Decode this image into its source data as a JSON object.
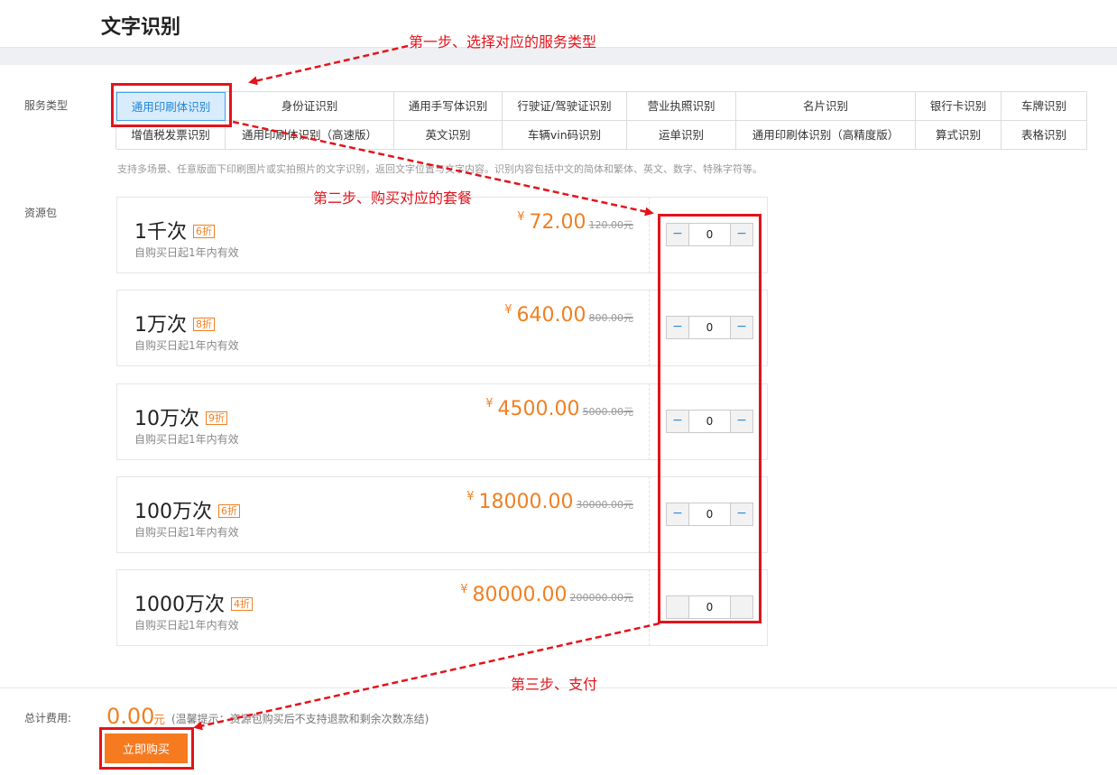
{
  "page": {
    "title": "文字识别"
  },
  "labels": {
    "service_type": "服务类型",
    "resource_pack": "资源包",
    "total_cost": "总计费用:"
  },
  "services": {
    "row1": [
      "通用印刷体识别",
      "身份证识别",
      "通用手写体识别",
      "行驶证/驾驶证识别",
      "营业执照识别",
      "名片识别",
      "银行卡识别",
      "车牌识别"
    ],
    "row2": [
      "增值税发票识别",
      "通用印刷体识别（高速版）",
      "英文识别",
      "车辆vin码识别",
      "运单识别",
      "通用印刷体识别（高精度版）",
      "算式识别",
      "表格识别"
    ],
    "selected": "通用印刷体识别"
  },
  "description": "支持多场景、任意版面下印刷图片或实拍照片的文字识别，返回文字位置与文字内容。识别内容包括中文的简体和繁体、英文、数字、特殊字符等。",
  "packages": [
    {
      "name": "1千次",
      "discount": "6折",
      "validity": "自购买日起1年内有效",
      "currency": "¥",
      "price": "72.00",
      "original_price": "120.00元",
      "quantity": "0",
      "minus": "−",
      "plus": "−"
    },
    {
      "name": "1万次",
      "discount": "8折",
      "validity": "自购买日起1年内有效",
      "currency": "¥",
      "price": "640.00",
      "original_price": "800.00元",
      "quantity": "0",
      "minus": "−",
      "plus": "−"
    },
    {
      "name": "10万次",
      "discount": "9折",
      "validity": "自购买日起1年内有效",
      "currency": "¥",
      "price": "4500.00",
      "original_price": "5000.00元",
      "quantity": "0",
      "minus": "−",
      "plus": "−"
    },
    {
      "name": "100万次",
      "discount": "6折",
      "validity": "自购买日起1年内有效",
      "currency": "¥",
      "price": "18000.00",
      "original_price": "30000.00元",
      "quantity": "0",
      "minus": "−",
      "plus": "−"
    },
    {
      "name": "1000万次",
      "discount": "4折",
      "validity": "自购买日起1年内有效",
      "currency": "¥",
      "price": "80000.00",
      "original_price": "200000.00元",
      "quantity": "0",
      "minus": "",
      "plus": ""
    }
  ],
  "total": {
    "amount": "0.00",
    "unit": "元",
    "note": "(温馨提示：资源包购买后不支持退款和剩余次数冻结)",
    "buy_label": "立即购买"
  },
  "annotations": {
    "step1": "第一步、选择对应的服务类型",
    "step2": "第二步、购买对应的套餐",
    "step3": "第三步、支付"
  },
  "colors": {
    "accent": "#f08022",
    "annotation": "#e3131b",
    "selected_bg": "#d9ecfb",
    "selected_text": "#1f86d9",
    "buy_button": "#f67a1f"
  }
}
